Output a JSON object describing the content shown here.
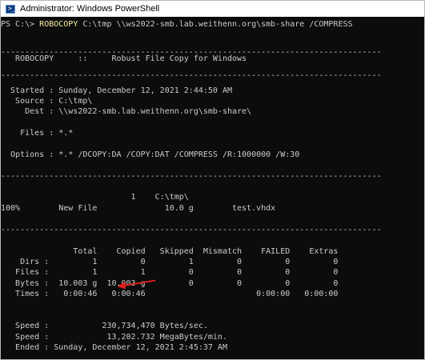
{
  "window": {
    "title": "Administrator: Windows PowerShell",
    "icon": "powershell-icon",
    "arrow_color": "#e0201b"
  },
  "console": {
    "prompt_prefix": "PS C:\\> ",
    "command": "ROBOCOPY",
    "command_args": " C:\\tmp \\\\ws2022-smb.lab.weithenn.org\\smb-share /COMPRESS",
    "lines": [
      "-------------------------------------------------------------------------------",
      "   ROBOCOPY     ::     Robust File Copy for Windows",
      "-------------------------------------------------------------------------------",
      "  Started : Sunday, December 12, 2021 2:44:50 AM",
      "   Source : C:\\tmp\\",
      "     Dest : \\\\ws2022-smb.lab.weithenn.org\\smb-share\\",
      "    Files : *.*",
      "  Options : *.* /DCOPY:DA /COPY:DAT /COMPRESS /R:1000000 /W:30",
      "-------------------------------------------------------------------------------",
      "                           1    C:\\tmp\\",
      "100%        New File              10.0 g        test.vhdx",
      "-------------------------------------------------------------------------------",
      "               Total    Copied   Skipped  Mismatch    FAILED    Extras",
      "    Dirs :         1         0         1         0         0         0",
      "   Files :         1         1         0         0         0         0",
      "   Bytes :  10.003 g  10.003 g         0         0         0         0",
      "   Times :   0:00:46   0:00:46                       0:00:00   0:00:00",
      "   Speed :           230,734,470 Bytes/sec.",
      "   Speed :            13,202.732 MegaBytes/min.",
      "   Ended : Sunday, December 12, 2021 2:45:37 AM"
    ]
  }
}
